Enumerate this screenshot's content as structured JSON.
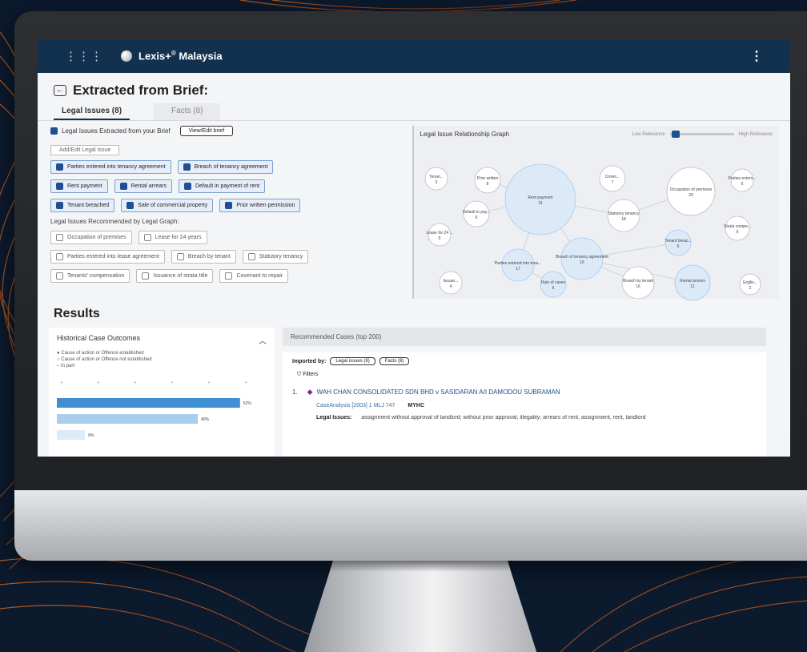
{
  "app": {
    "brand": "Lexis+",
    "brand_sup": "®",
    "brand_region": "Malaysia"
  },
  "page": {
    "title": "Extracted from Brief:",
    "tabs": [
      {
        "label": "Legal Issues (8)",
        "active": true
      },
      {
        "label": "Facts (8)",
        "active": false
      }
    ]
  },
  "issues": {
    "header": "Legal Issues Extracted from your Brief",
    "view_button": "View/Edit brief",
    "add_button": "Add/Edit Legal Issue",
    "extracted_rows": [
      [
        "Parties entered into tenancy agreement",
        "Breach of tenancy agreement"
      ],
      [
        "Rent payment",
        "Rental arrears",
        "Default in payment of rent"
      ],
      [
        "Tenant breached",
        "Sale of commercial property",
        "Prior written permission"
      ]
    ],
    "recommended_label": "Legal Issues Recommended by Legal Graph:",
    "recommended_rows": [
      [
        "Occupation of premises",
        "Lease for 24 years"
      ],
      [
        "Parties entered into lease agreement",
        "Breach by tenant",
        "Statutory tenancy"
      ],
      [
        "Tenants' compensation",
        "Issuance of strata title",
        "Covenant to repair"
      ]
    ]
  },
  "graph": {
    "title": "Legal Issue Relationship Graph",
    "low_label": "Low Relevance",
    "high_label": "High Relevance",
    "slider_level": 0.1,
    "nodes": [
      {
        "label": "Rent payment",
        "count": "31"
      },
      {
        "label": "Occupation of premises",
        "count": "29"
      },
      {
        "label": "Breach of tenancy agreement",
        "count": "16"
      },
      {
        "label": "Statutory tenancy",
        "count": "18"
      },
      {
        "label": "Parties entered into tena...",
        "count": "17"
      },
      {
        "label": "Breach by tenant",
        "count": "16"
      },
      {
        "label": "Rental arrears",
        "count": "11"
      },
      {
        "label": "Tenant breac...",
        "count": "5"
      },
      {
        "label": "Prior written",
        "count": "8"
      },
      {
        "label": "Default in pay...",
        "count": "6"
      },
      {
        "label": "Rule of cases",
        "count": "6"
      },
      {
        "label": "Coven...",
        "count": "7"
      },
      {
        "label": "Parties enters...",
        "count": "6"
      },
      {
        "label": "Lease for 24 ...",
        "count": "5"
      },
      {
        "label": "Tenan...",
        "count": "3"
      },
      {
        "label": "Issuan...",
        "count": "4"
      },
      {
        "label": "Strata compe...",
        "count": "6"
      },
      {
        "label": "Englis...",
        "count": "2"
      }
    ]
  },
  "results": {
    "title": "Results",
    "outcomes": {
      "title": "Historical Case Outcomes",
      "legend": [
        "Cause of action or Offence established",
        "Cause of action or Offence not established",
        "In part"
      ],
      "bars": [
        {
          "value": 52,
          "label": "52%"
        },
        {
          "value": 40,
          "label": "40%"
        },
        {
          "value": 8,
          "label": "8%"
        }
      ],
      "colors": [
        "#3f8fd2",
        "#a9cdec",
        "#dcebf8"
      ]
    },
    "cases": {
      "tab_label": "Recommended Cases (top 200)",
      "imported_by": "Imported by:",
      "pills": [
        "Legal issues (8)",
        "Facts (8)"
      ],
      "filters": "Filters",
      "first_case": {
        "num": "1.",
        "title": "WAH CHAN CONSOLIDATED SDN BHD v SASIDARAN A/I DAMODOU SUBRAMAN",
        "cite": "CaseAnalysis [2003] 1 MLJ 747",
        "court": "MYHC",
        "issues_label": "Legal Issues:",
        "issues_text": "assignment without approval of landlord; without prior approval; illegality; arrears of rent, assignment, rent, landlord"
      }
    }
  }
}
